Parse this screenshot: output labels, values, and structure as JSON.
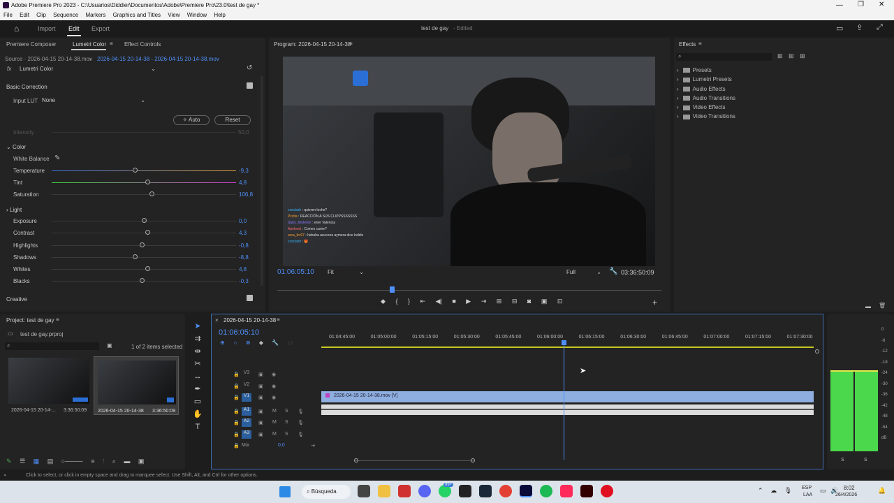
{
  "window": {
    "title": "Adobe Premiere Pro 2023 - C:\\Usuarios\\Diddier\\Documentos\\Adobe\\Premiere Pro\\23.0\\test de gay *"
  },
  "menu": [
    "File",
    "Edit",
    "Clip",
    "Sequence",
    "Markers",
    "Graphics and Titles",
    "View",
    "Window",
    "Help"
  ],
  "topbar": {
    "import": "Import",
    "edit": "Edit",
    "export": "Export",
    "project_name": "test de gay",
    "status": "- Edited"
  },
  "left_tabs": [
    "Premiere Composer",
    "Lumetri Color",
    "Effect Controls"
  ],
  "source": {
    "label": "Source · 2026-04-15 20-14-38.mov",
    "seq": "2026-04-15 20-14-38 - 2026-04-15 20-14-38.mov",
    "fx": "fx",
    "effect": "Lumetri Color"
  },
  "lumetri": {
    "basic_correction": "Basic Correction",
    "input_lut_label": "Input LUT",
    "input_lut_value": "None",
    "auto": "Auto",
    "reset": "Reset",
    "intensity": "Intensity",
    "intensity_val": "50,0",
    "color": "Color",
    "white_balance": "White Balance",
    "light": "Light",
    "creative": "Creative",
    "sliders": [
      {
        "label": "Temperature",
        "value": "-9,3",
        "pos": 0.45
      },
      {
        "label": "Tint",
        "value": "4,8",
        "pos": 0.52
      },
      {
        "label": "Saturation",
        "value": "106,8",
        "pos": 0.54
      },
      {
        "label": "Exposure",
        "value": "0,0",
        "pos": 0.5
      },
      {
        "label": "Contrast",
        "value": "4,3",
        "pos": 0.52
      },
      {
        "label": "Highlights",
        "value": "-0,8",
        "pos": 0.49
      },
      {
        "label": "Shadows",
        "value": "-8,8",
        "pos": 0.45
      },
      {
        "label": "Whites",
        "value": "4,8",
        "pos": 0.52
      },
      {
        "label": "Blacks",
        "value": "-0,3",
        "pos": 0.49
      }
    ]
  },
  "program": {
    "title": "Program: 2026-04-15 20-14-38",
    "timecode": "01:06:05:10",
    "fit": "Fit",
    "full": "Full",
    "duration": "03:36:50:09",
    "chat": [
      {
        "user": "cxxclash",
        "msg": ": quieren leche?",
        "color": "#3ab4ff"
      },
      {
        "user": "Pczlta",
        "msg": ": REACCIÓN A SUS CLIPPSSSSSSS",
        "color": "#ff9f2e"
      },
      {
        "user": "Stary_frederick",
        "msg": ": ener Valencia",
        "color": "#8a7bff"
      },
      {
        "user": "Apoloxal",
        "msg": ": Comes carne?",
        "color": "#ff6a6a"
      },
      {
        "user": "arca_for97",
        "msg": ": hahaha azucena aymera dice loddix",
        "color": "#ff9f2e"
      },
      {
        "user": "cxxclash",
        "msg": ": 🎁",
        "color": "#3ab4ff"
      }
    ]
  },
  "effects": {
    "title": "Effects",
    "items": [
      "Presets",
      "Lumetri Presets",
      "Audio Effects",
      "Audio Transitions",
      "Video Effects",
      "Video Transitions"
    ]
  },
  "project": {
    "title": "Project: test de gay",
    "file": "test de gay.prproj",
    "selected": "1 of 2 items selected",
    "items": [
      {
        "name": "2026-04-15 20-14-...",
        "dur": "3:36:50:09"
      },
      {
        "name": "2026-04-15 20-14-38",
        "dur": "3:36:50:09"
      }
    ]
  },
  "timeline": {
    "tab": "2026-04-15 20-14-38",
    "timecode": "01:06:05:10",
    "ticks": [
      "01:04:45:00",
      "01:05:00:00",
      "01:05:15:00",
      "01:05:30:00",
      "01:05:45:00",
      "01:06:00:00",
      "01:06:15:00",
      "01:06:30:00",
      "01:06:45:00",
      "01:07:00:00",
      "01:07:15:00",
      "01:07:30:00"
    ],
    "tracks": [
      "V3",
      "V2",
      "V1",
      "A1",
      "A2",
      "A3"
    ],
    "mix": "Mix",
    "mix_val": "0,0",
    "clip": "2026-04-15 20-14-38.mov [V]",
    "m": "M",
    "s": "S"
  },
  "meter": {
    "labels": [
      "0",
      "-6",
      "-12",
      "-18",
      "-24",
      "-30",
      "-36",
      "-42",
      "-48",
      "-54",
      "dB"
    ],
    "s": "S"
  },
  "status": "Click to select, or click in empty space and drag to marquee select. Use Shift, Alt, and Ctrl for other options.",
  "taskbar": {
    "search": "Búsqueda",
    "lang1": "ESP",
    "lang2": "LAA",
    "time": "8:02",
    "date": "26/4/2026",
    "badge": "99+"
  }
}
